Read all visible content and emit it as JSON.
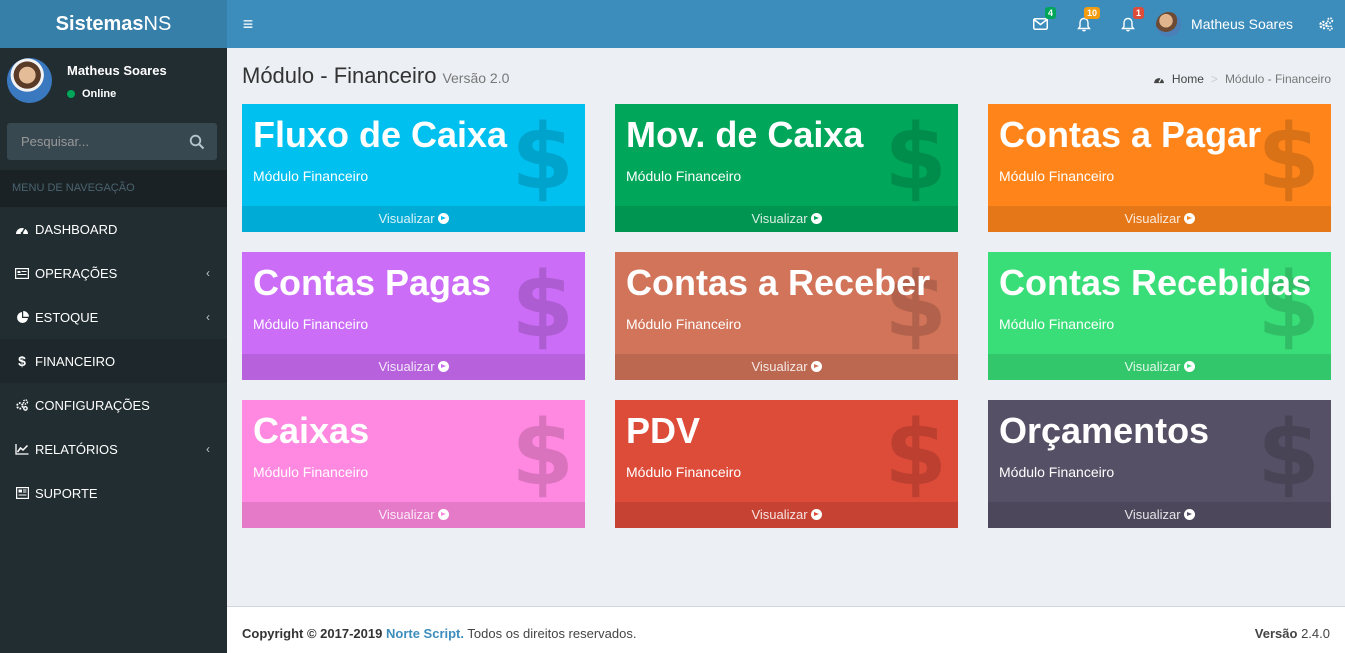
{
  "app": {
    "logo_bold": "Sistemas",
    "logo_rest": "NS"
  },
  "topbar": {
    "notifications": [
      {
        "icon": "envelope-icon",
        "count": "4",
        "color": "#00a65a"
      },
      {
        "icon": "bell-icon",
        "count": "10",
        "color": "#f39c12"
      },
      {
        "icon": "bell-icon",
        "count": "1",
        "color": "#dd4b39"
      }
    ],
    "user_name": "Matheus Soares"
  },
  "sidebar": {
    "user_name": "Matheus Soares",
    "status": "Online",
    "search_placeholder": "Pesquisar...",
    "menu_header": "MENU DE NAVEGAÇÃO",
    "items": [
      {
        "label": "DASHBOARD",
        "icon": "dashboard-icon"
      },
      {
        "label": "OPERAÇÕES",
        "icon": "list-icon"
      },
      {
        "label": "ESTOQUE",
        "icon": "pie-chart-icon"
      },
      {
        "label": "FINANCEIRO",
        "icon": "dollar-icon"
      },
      {
        "label": "CONFIGURAÇÕES",
        "icon": "gears-icon"
      },
      {
        "label": "RELATÓRIOS",
        "icon": "line-chart-icon"
      },
      {
        "label": "SUPORTE",
        "icon": "newspaper-icon"
      }
    ]
  },
  "page": {
    "title": "Módulo - Financeiro",
    "version": "Versão 2.0",
    "breadcrumb_home": "Home",
    "breadcrumb_current": "Módulo - Financeiro"
  },
  "boxes": [
    {
      "title": "Fluxo de Caixa",
      "subtitle": "Módulo Financeiro",
      "link": "Visualizar",
      "color": "#00c0ef"
    },
    {
      "title": "Mov. de Caixa",
      "subtitle": "Módulo Financeiro",
      "link": "Visualizar",
      "color": "#00a65a"
    },
    {
      "title": "Contas a Pagar",
      "subtitle": "Módulo Financeiro",
      "link": "Visualizar",
      "color": "#ff851b"
    },
    {
      "title": "Contas Pagas",
      "subtitle": "Módulo Financeiro",
      "link": "Visualizar",
      "color": "#cc6df7"
    },
    {
      "title": "Contas a Receber",
      "subtitle": "Módulo Financeiro",
      "link": "Visualizar",
      "color": "#d2745a"
    },
    {
      "title": "Contas Recebidas",
      "subtitle": "Módulo Financeiro",
      "link": "Visualizar",
      "color": "#39de78"
    },
    {
      "title": "Caixas",
      "subtitle": "Módulo Financeiro",
      "link": "Visualizar",
      "color": "#ff88e0"
    },
    {
      "title": "PDV",
      "subtitle": "Módulo Financeiro",
      "link": "Visualizar",
      "color": "#dd4b39"
    },
    {
      "title": "Orçamentos",
      "subtitle": "Módulo Financeiro",
      "link": "Visualizar",
      "color": "#555065"
    }
  ],
  "footer": {
    "copyright": "Copyright © 2017-2019",
    "company": "Norte Script.",
    "rights": "Todos os direitos reservados.",
    "version_label": "Versão",
    "version_value": "2.4.0"
  }
}
